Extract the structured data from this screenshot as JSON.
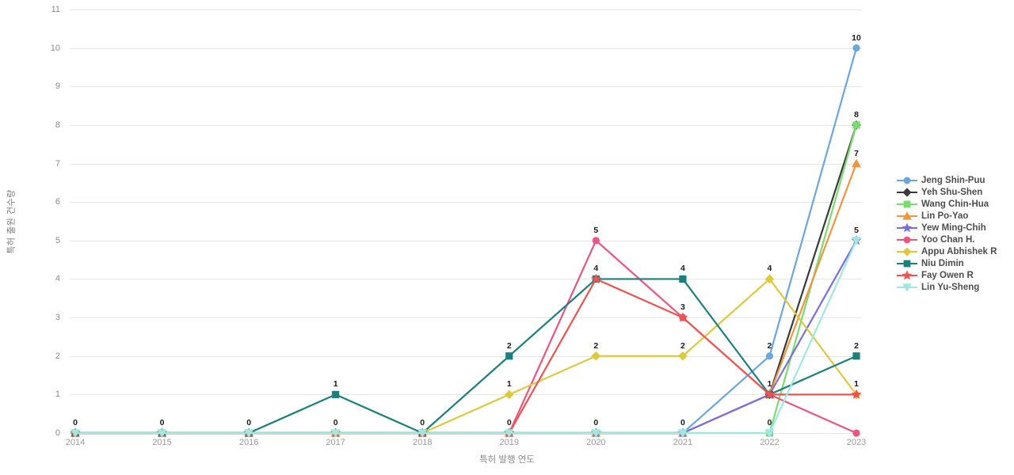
{
  "chart_data": {
    "type": "line",
    "title": "",
    "xlabel": "특허 발행 연도",
    "ylabel": "특허 출원 건수량",
    "categories": [
      "2014",
      "2015",
      "2016",
      "2017",
      "2018",
      "2019",
      "2020",
      "2021",
      "2022",
      "2023"
    ],
    "x": [
      2014,
      2015,
      2016,
      2017,
      2018,
      2019,
      2020,
      2021,
      2022,
      2023
    ],
    "ylim": [
      0,
      11
    ],
    "xlim": [
      2014,
      2023
    ],
    "yticks": [
      0,
      1,
      2,
      3,
      4,
      5,
      6,
      7,
      8,
      9,
      10,
      11
    ],
    "grid": "horizontal",
    "legend_position": "right",
    "data_labels": true,
    "series": [
      {
        "name": "Jeng Shin-Puu",
        "color": "#6aa6e0",
        "marker": "circle",
        "values": [
          0,
          0,
          0,
          0,
          0,
          0,
          0,
          0,
          2,
          10
        ]
      },
      {
        "name": "Yeh Shu-Shen",
        "color": "#3a3a3a",
        "marker": "diamond",
        "values": [
          0,
          0,
          0,
          0,
          0,
          0,
          0,
          0,
          1,
          8
        ]
      },
      {
        "name": "Wang Chin-Hua",
        "color": "#79dd6e",
        "marker": "square",
        "values": [
          0,
          0,
          0,
          0,
          0,
          0,
          0,
          0,
          0,
          8
        ]
      },
      {
        "name": "Lin Po-Yao",
        "color": "#f2953f",
        "marker": "triangle-up",
        "values": [
          0,
          0,
          0,
          0,
          0,
          0,
          0,
          0,
          1,
          7
        ]
      },
      {
        "name": "Yew Ming-Chih",
        "color": "#7b6fe0",
        "marker": "star",
        "values": [
          0,
          0,
          0,
          0,
          0,
          0,
          0,
          0,
          1,
          5
        ]
      },
      {
        "name": "Yoo Chan H.",
        "color": "#ec5580",
        "marker": "circle",
        "values": [
          0,
          0,
          0,
          0,
          0,
          0,
          5,
          3,
          1,
          0
        ]
      },
      {
        "name": "Appu Abhishek R",
        "color": "#e0c83c",
        "marker": "diamond",
        "values": [
          0,
          0,
          0,
          0,
          0,
          1,
          2,
          2,
          4,
          1
        ]
      },
      {
        "name": "Niu Dimin",
        "color": "#1a7f7f",
        "marker": "square",
        "values": [
          0,
          0,
          0,
          1,
          0,
          2,
          4,
          4,
          1,
          2
        ]
      },
      {
        "name": "Fay Owen R",
        "color": "#ef5350",
        "marker": "star",
        "values": [
          0,
          0,
          0,
          0,
          0,
          0,
          4,
          3,
          1,
          1
        ]
      },
      {
        "name": "Lin Yu-Sheng",
        "color": "#9fe8e0",
        "marker": "triangle-down",
        "values": [
          0,
          0,
          0,
          0,
          0,
          0,
          0,
          0,
          0,
          5
        ]
      }
    ],
    "annotations": [
      {
        "x": "2014",
        "y": 0,
        "text": "0"
      },
      {
        "x": "2015",
        "y": 0,
        "text": "0"
      },
      {
        "x": "2016",
        "y": 0,
        "text": "0"
      },
      {
        "x": "2017",
        "y": 0,
        "text": "0"
      },
      {
        "x": "2017",
        "y": 1,
        "text": "1"
      },
      {
        "x": "2018",
        "y": 0,
        "text": "0"
      },
      {
        "x": "2019",
        "y": 0,
        "text": "0"
      },
      {
        "x": "2019",
        "y": 1,
        "text": "1"
      },
      {
        "x": "2019",
        "y": 2,
        "text": "2"
      },
      {
        "x": "2020",
        "y": 0,
        "text": "0"
      },
      {
        "x": "2020",
        "y": 2,
        "text": "2"
      },
      {
        "x": "2020",
        "y": 4,
        "text": "4"
      },
      {
        "x": "2020",
        "y": 5,
        "text": "5"
      },
      {
        "x": "2021",
        "y": 0,
        "text": "0"
      },
      {
        "x": "2021",
        "y": 2,
        "text": "2"
      },
      {
        "x": "2021",
        "y": 3,
        "text": "3"
      },
      {
        "x": "2021",
        "y": 4,
        "text": "4"
      },
      {
        "x": "2022",
        "y": 0,
        "text": "0"
      },
      {
        "x": "2022",
        "y": 1,
        "text": "1"
      },
      {
        "x": "2022",
        "y": 2,
        "text": "2"
      },
      {
        "x": "2022",
        "y": 4,
        "text": "4"
      },
      {
        "x": "2023",
        "y": 1,
        "text": "1"
      },
      {
        "x": "2023",
        "y": 2,
        "text": "2"
      },
      {
        "x": "2023",
        "y": 5,
        "text": "5"
      },
      {
        "x": "2023",
        "y": 7,
        "text": "7"
      },
      {
        "x": "2023",
        "y": 8,
        "text": "8"
      },
      {
        "x": "2023",
        "y": 10,
        "text": "10"
      }
    ]
  },
  "legend": {
    "items": [
      {
        "label": "Jeng Shin-Puu"
      },
      {
        "label": "Yeh Shu-Shen"
      },
      {
        "label": "Wang Chin-Hua"
      },
      {
        "label": "Lin Po-Yao"
      },
      {
        "label": "Yew Ming-Chih"
      },
      {
        "label": "Yoo Chan H."
      },
      {
        "label": "Appu Abhishek R"
      },
      {
        "label": "Niu Dimin"
      },
      {
        "label": "Fay Owen R"
      },
      {
        "label": "Lin Yu-Sheng"
      }
    ]
  },
  "axes": {
    "x_title": "특허 발행 연도",
    "y_title": "특허 출원 건수량",
    "x_ticks": [
      "2014",
      "2015",
      "2016",
      "2017",
      "2018",
      "2019",
      "2020",
      "2021",
      "2022",
      "2023"
    ],
    "y_ticks": [
      "0",
      "1",
      "2",
      "3",
      "4",
      "5",
      "6",
      "7",
      "8",
      "9",
      "10",
      "11"
    ]
  },
  "colors": {
    "grid": "#e6e6e6",
    "tick_text": "#8a8a8a",
    "label_text": "#1b1b1b",
    "legend_text": "#4d4d4d",
    "background": "#ffffff"
  }
}
